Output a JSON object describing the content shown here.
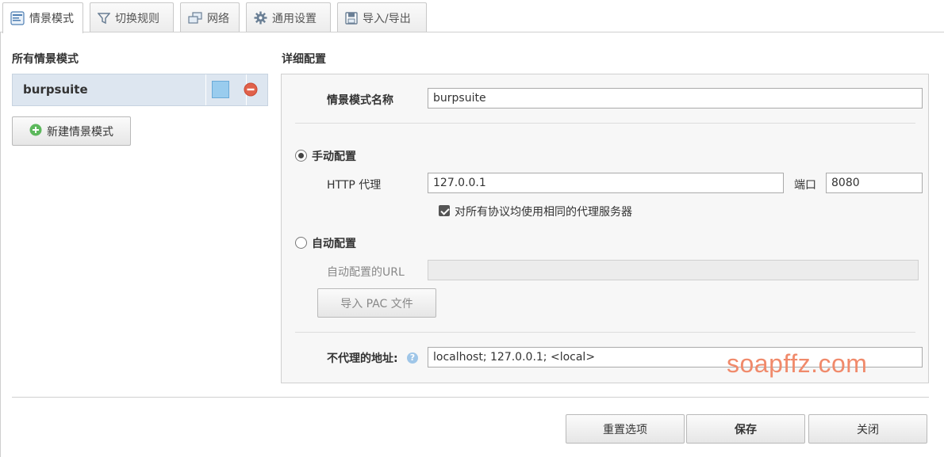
{
  "tabs": [
    {
      "label": "情景模式",
      "icon": "profile-icon",
      "active": true
    },
    {
      "label": "切换规则",
      "icon": "filter-icon",
      "active": false
    },
    {
      "label": "网络",
      "icon": "network-icon",
      "active": false
    },
    {
      "label": "通用设置",
      "icon": "gear-icon",
      "active": false
    },
    {
      "label": "导入/导出",
      "icon": "save-icon",
      "active": false
    }
  ],
  "sidebar": {
    "heading": "所有情景模式",
    "profiles": [
      {
        "name": "burpsuite",
        "color": "#99ccee"
      }
    ],
    "new_button": "新建情景模式"
  },
  "detail": {
    "heading": "详细配置",
    "name_label": "情景模式名称",
    "name_value": "burpsuite",
    "manual": {
      "label": "手动配置",
      "checked": true,
      "http_label": "HTTP 代理",
      "http_value": "127.0.0.1",
      "port_label": "端口",
      "port_value": "8080",
      "same_proxy_label": "对所有协议均使用相同的代理服务器",
      "same_proxy_checked": true
    },
    "auto": {
      "label": "自动配置",
      "checked": false,
      "url_label": "自动配置的URL",
      "url_value": "",
      "import_pac_button": "导入 PAC 文件"
    },
    "bypass": {
      "label": "不代理的地址:",
      "value": "localhost; 127.0.0.1; <local>",
      "help": "?"
    }
  },
  "footer": {
    "reset": "重置选项",
    "save": "保存",
    "close": "关闭"
  },
  "watermark": "soapffz.com"
}
